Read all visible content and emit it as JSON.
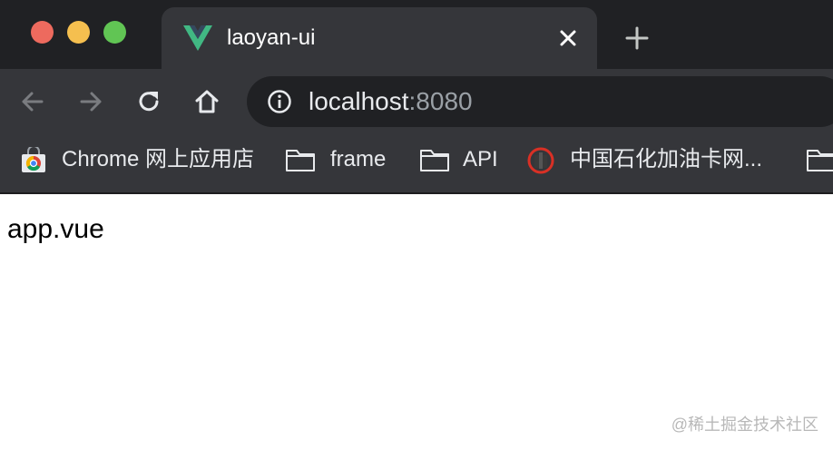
{
  "window": {
    "controls": [
      "close",
      "minimize",
      "maximize"
    ]
  },
  "tab": {
    "title": "laoyan-ui",
    "favicon": "vue-logo-icon",
    "close_icon": "close-icon"
  },
  "new_tab_icon": "plus-icon",
  "toolbar": {
    "back_icon": "arrow-left-icon",
    "forward_icon": "arrow-right-icon",
    "reload_icon": "reload-icon",
    "home_icon": "home-icon",
    "url_info_icon": "info-icon",
    "url_host": "localhost",
    "url_port": ":8080"
  },
  "bookmarks": [
    {
      "label": "Chrome 网上应用店",
      "icon": "chrome-web-store-icon"
    },
    {
      "label": "frame",
      "icon": "folder-icon"
    },
    {
      "label": "API",
      "icon": "folder-icon"
    },
    {
      "label": "中国石化加油卡网...",
      "icon": "sinopec-icon"
    },
    {
      "label": "",
      "icon": "folder-icon"
    }
  ],
  "page": {
    "content": "app.vue"
  },
  "watermark": "@稀土掘金技术社区",
  "colors": {
    "titlebar": "#202124",
    "toolbar": "#35363a",
    "close": "#ed6a5e",
    "minimize": "#f5bf4f",
    "maximize": "#61c554",
    "vue_green": "#41b883",
    "vue_dark": "#35495e"
  }
}
